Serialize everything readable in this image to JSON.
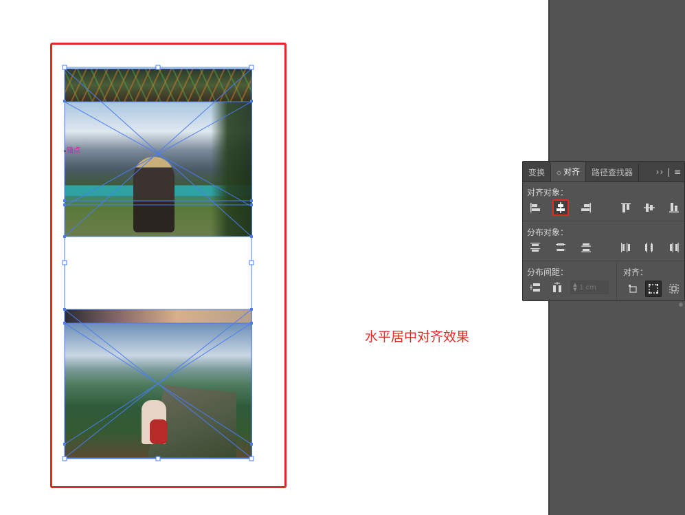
{
  "canvas": {
    "caption": "水平居中对齐效果",
    "marker_text": "锚点",
    "marker_arrow": "»"
  },
  "align_panel": {
    "tabs": [
      {
        "label": "变换",
        "active": false
      },
      {
        "label": "对齐",
        "active": true
      },
      {
        "label": "路径查找器",
        "active": false
      }
    ],
    "tab_updown_glyph": "◇",
    "menu_glyph": "›› | ≡",
    "align_objects_label": "对齐对象：",
    "distribute_objects_label": "分布对象：",
    "distribute_spacing_label": "分布间距：",
    "align_to_label": "对齐：",
    "spacing_value_placeholder": "1 cm",
    "accent_color": "#e02a22",
    "selection_color": "#4a7cf0"
  }
}
